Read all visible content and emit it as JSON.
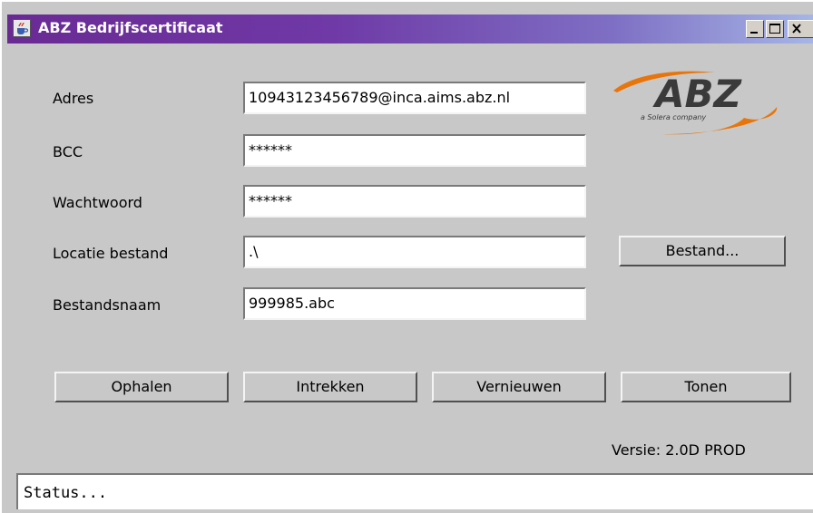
{
  "window": {
    "title": "ABZ Bedrijfscertificaat",
    "icon": "java-cup-icon",
    "controls": {
      "minimize": "minimize-icon",
      "maximize": "maximize-icon",
      "close": "close-icon"
    }
  },
  "logo": {
    "brand": "ABZ",
    "tagline": "a Solera company",
    "accent_color": "#e8750a",
    "text_color": "#3a3a3a"
  },
  "form": {
    "adres": {
      "label": "Adres",
      "value": "10943123456789@inca.aims.abz.nl"
    },
    "bcc": {
      "label": "BCC",
      "value": "******"
    },
    "wachtwoord": {
      "label": "Wachtwoord",
      "value": "******"
    },
    "locatie": {
      "label": "Locatie bestand",
      "value": ".\\"
    },
    "bestandsnaam": {
      "label": "Bestandsnaam",
      "value": "999985.abc"
    }
  },
  "buttons": {
    "bestand": "Bestand...",
    "ophalen": "Ophalen",
    "intrekken": "Intrekken",
    "vernieuwen": "Vernieuwen",
    "tonen": "Tonen"
  },
  "version": "Versie: 2.0D PROD",
  "status": "Status...",
  "colors": {
    "titlebar_start": "#6a2a94",
    "titlebar_end": "#a6b6e6",
    "window_bg": "#c8c8c8"
  }
}
